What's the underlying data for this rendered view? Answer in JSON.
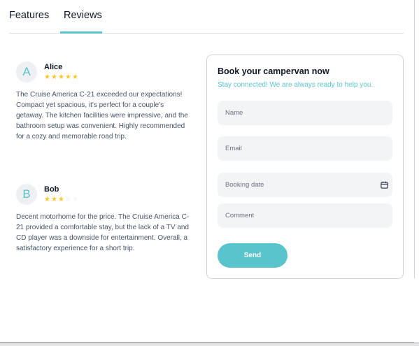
{
  "tabs": {
    "features": "Features",
    "reviews": "Reviews",
    "active": "Reviews"
  },
  "reviews": [
    {
      "initial": "A",
      "name": "Alice",
      "rating": 5,
      "text": "The Cruise America C-21 exceeded our expectations! Compact yet spacious, it's perfect for a couple's getaway. The kitchen facilities were impressive, and the bathroom setup was convenient. Highly recommended for a cozy and memorable road trip."
    },
    {
      "initial": "B",
      "name": "Bob",
      "rating": 3,
      "text": "Decent motorhome for the price. The Cruise America C-21 provided a comfortable stay, but the lack of a TV and CD player was a downside for entertainment. Overall, a satisfactory experience for a short trip."
    }
  ],
  "booking": {
    "title": "Book your campervan now",
    "subtitle": "Stay connected! We are always ready to help you.",
    "name_placeholder": "Name",
    "email_placeholder": "Email",
    "date_placeholder": "Booking date",
    "comment_placeholder": "Comment",
    "send_label": "Send",
    "date_icon": "calendar-icon"
  },
  "colors": {
    "accent": "#5ac4cc",
    "star": "#ffc531",
    "star_empty": "#f2f4f7",
    "field_bg": "#f3f4f6",
    "text": "#101828",
    "muted": "#475467"
  }
}
